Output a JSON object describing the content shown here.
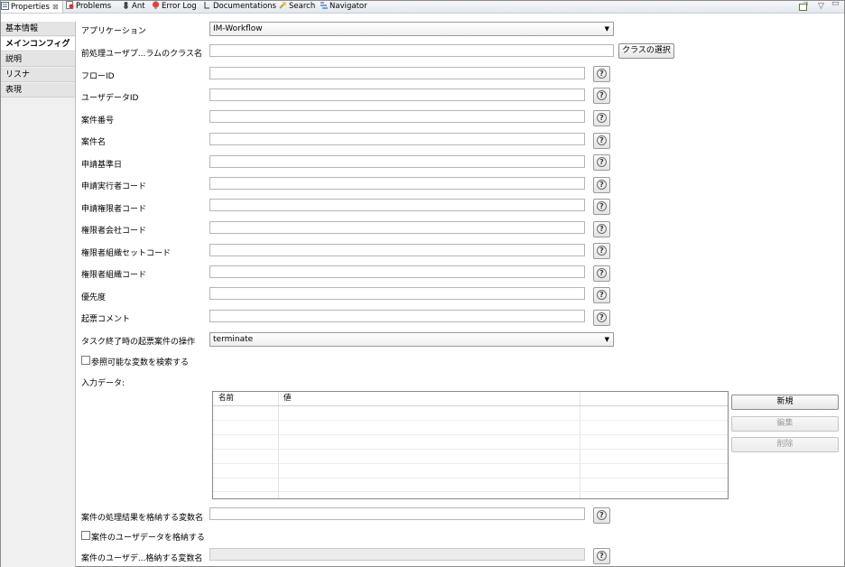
{
  "view_tabs": [
    {
      "label": "Properties",
      "icon": "properties-icon",
      "active": true
    },
    {
      "label": "Problems",
      "icon": "problems-icon"
    },
    {
      "label": "Ant",
      "icon": "ant-icon"
    },
    {
      "label": "Error Log",
      "icon": "error-log-icon"
    },
    {
      "label": "Documentations",
      "icon": "documentations-icon"
    },
    {
      "label": "Search",
      "icon": "search-icon"
    },
    {
      "label": "Navigator",
      "icon": "navigator-icon"
    }
  ],
  "side_tabs": [
    {
      "label": "基本情報"
    },
    {
      "label": "メインコンフィグ",
      "active": true
    },
    {
      "label": "説明"
    },
    {
      "label": "リスナ"
    },
    {
      "label": "表現"
    }
  ],
  "form": {
    "application_label": "アプリケーション",
    "application_value": "IM-Workflow",
    "preprocess_label": "前処理ユーザプ...ラムのクラス名",
    "class_select_button": "クラスの選択",
    "help_glyph": "?",
    "fields": [
      {
        "label": "フローID"
      },
      {
        "label": "ユーザデータID"
      },
      {
        "label": "案件番号"
      },
      {
        "label": "案件名"
      },
      {
        "label": "申請基準日"
      },
      {
        "label": "申請実行者コード"
      },
      {
        "label": "申請権限者コード"
      },
      {
        "label": "権限者会社コード"
      },
      {
        "label": "権限者組織セットコード"
      },
      {
        "label": "権限者組織コード"
      },
      {
        "label": "優先度"
      },
      {
        "label": "起票コメント"
      }
    ],
    "task_end_label": "タスク終了時の起票案件の操作",
    "task_end_value": "terminate",
    "search_vars_label": "参照可能な変数を検索する",
    "input_data_label": "入力データ:",
    "table_headers": [
      "名前",
      "値"
    ],
    "new_button": "新規",
    "edit_button": "編集",
    "delete_button": "削除",
    "result_var_label": "案件の処理結果を格納する変数名",
    "store_userdata_label": "案件のユーザデータを格納する",
    "userdata_var_label": "案件のユーザデ...格納する変数名"
  }
}
